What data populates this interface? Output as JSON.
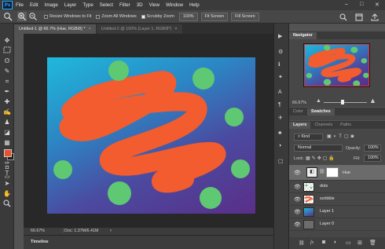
{
  "app": {
    "logo": "Ps"
  },
  "menu": [
    "File",
    "Edit",
    "Image",
    "Layer",
    "Type",
    "Select",
    "Filter",
    "3D",
    "View",
    "Window",
    "Help"
  ],
  "window_controls": {
    "minimize": "–",
    "maximize": "□",
    "close": "✕"
  },
  "options_bar": {
    "resize_windows": "Resize Windows to Fit",
    "zoom_all": "Zoom All Windows",
    "scrubby_zoom": "Scrubby Zoom",
    "zoom_pct": "100%",
    "fit_screen": "Fit Screen",
    "fill_screen": "Fill Screen"
  },
  "tabs": [
    {
      "label": "Untitled-1 @ 66.7% (Hue, RGB/8) *",
      "close": "×"
    },
    {
      "label": "Untitled-2 @ 100% (Layer 1, RGB/8*)",
      "close": "×"
    }
  ],
  "status": {
    "zoom": "66.67%",
    "doc": "Doc: 1.37M/6.41M"
  },
  "timeline": {
    "label": "Timeline"
  },
  "navigator": {
    "tab": "Navigator",
    "zoom": "66.67%"
  },
  "color_swatches": {
    "tabs": [
      "Color",
      "Swatches"
    ]
  },
  "layers_panel": {
    "tabs": [
      "Layers",
      "Channels",
      "Paths"
    ],
    "kind": "Kind",
    "blend": "Normal",
    "opacity_label": "Opacity:",
    "opacity": "100%",
    "lock_label": "Lock:",
    "fill_label": "Fill:",
    "fill": "100%",
    "layers": [
      {
        "name": "Hue",
        "type": "adjustment"
      },
      {
        "name": "dots",
        "type": "dots"
      },
      {
        "name": "scribble",
        "type": "scribble"
      },
      {
        "name": "Layer 1",
        "type": "gradient"
      },
      {
        "name": "Layer 0",
        "type": "gray"
      }
    ],
    "footer_icons": [
      "link-icon",
      "fx-icon",
      "mask-icon",
      "adjustment-icon",
      "folder-icon",
      "new-layer-icon",
      "trash-icon"
    ],
    "footer_fx": "fx"
  },
  "colors": {
    "foreground": "#e8502e",
    "background": "#1e1e1e",
    "scribble": "#f25c2e",
    "dots": "#5fc872"
  }
}
